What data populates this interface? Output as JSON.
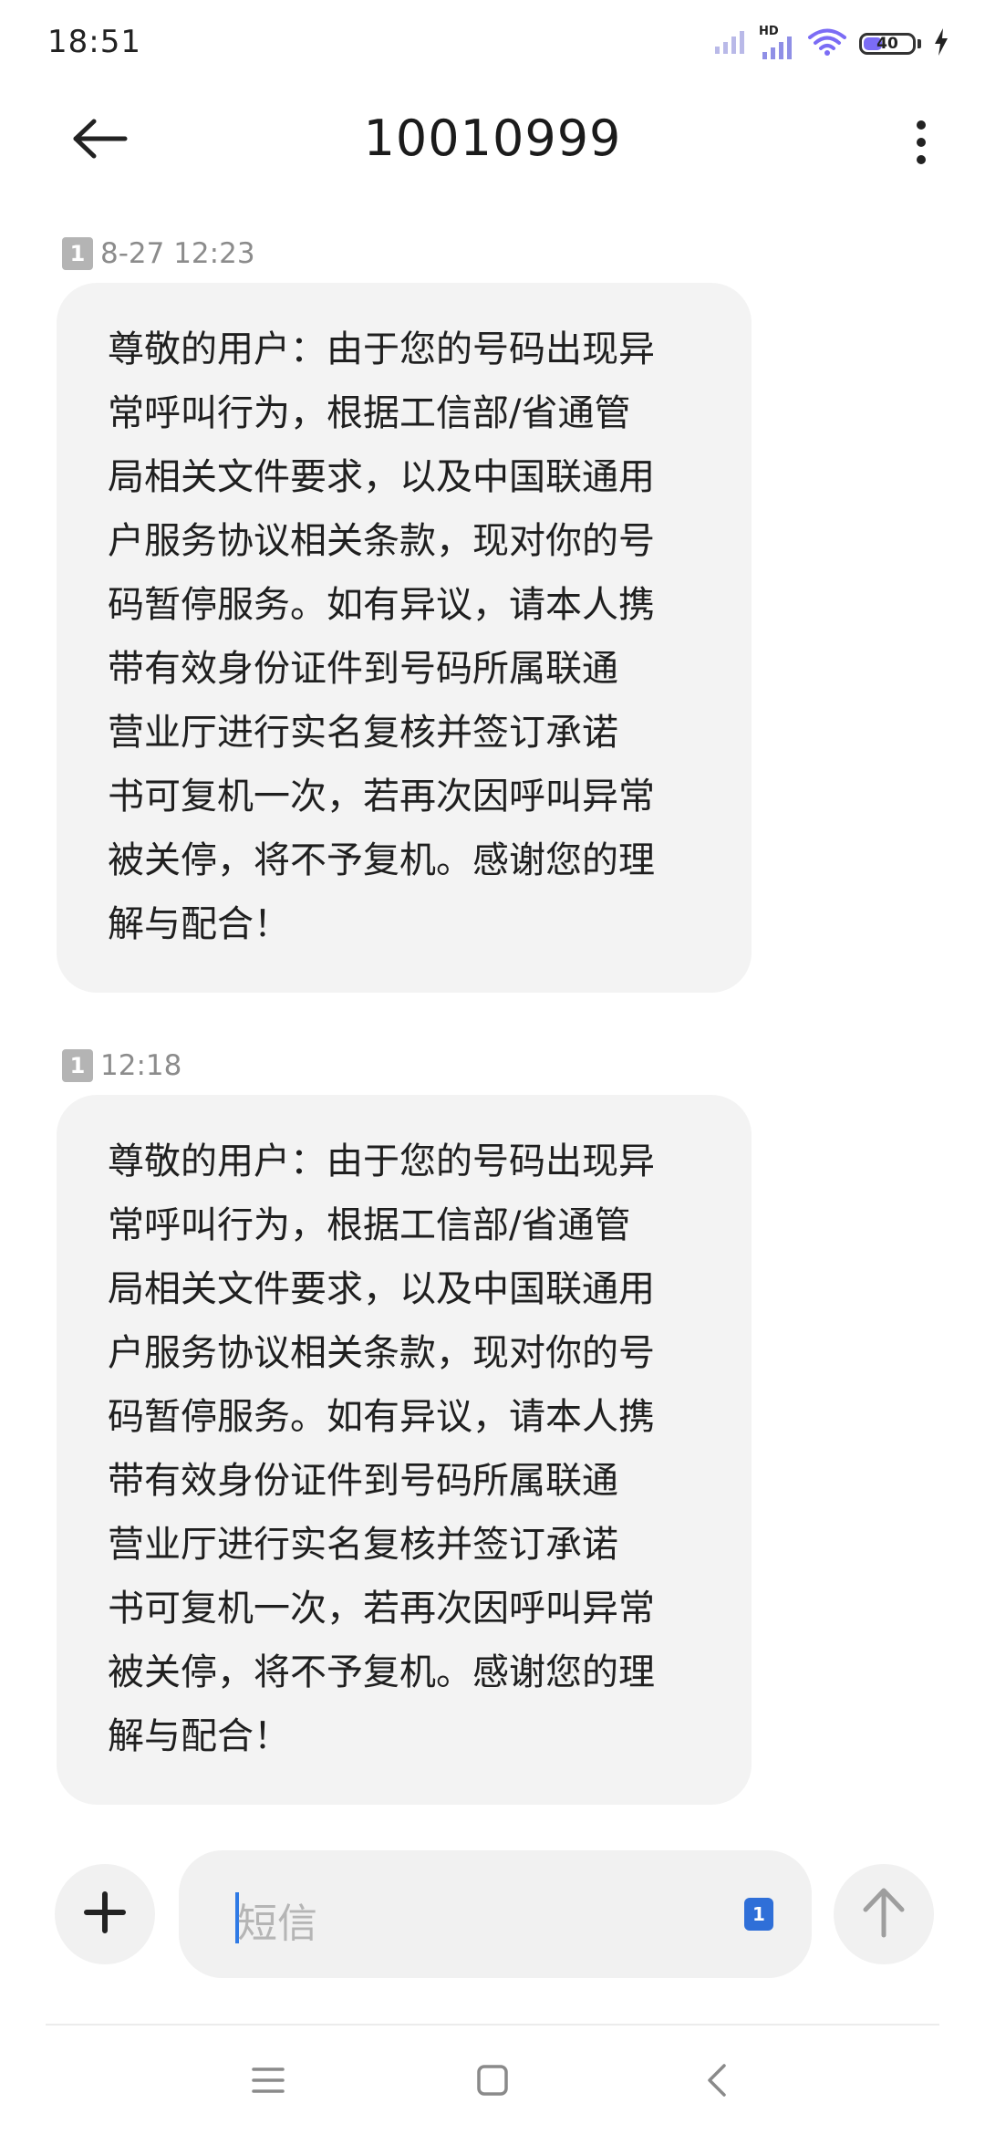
{
  "status_bar": {
    "time": "18:51",
    "hd_label": "HD",
    "battery_level": "40",
    "battery_percent": 40,
    "icons": [
      "signal-icon",
      "signal-hd-icon",
      "wifi-icon",
      "battery-icon",
      "charging-bolt-icon"
    ]
  },
  "header": {
    "title": "10010999",
    "back_icon": "arrow-left-icon",
    "more_icon": "more-vertical-icon"
  },
  "messages": [
    {
      "sim": "1",
      "time": "8-27 12:23",
      "text": "尊敬的用户：由于您的号码出现异\n常呼叫行为，根据工信部/省通管\n局相关文件要求，以及中国联通用\n户服务协议相关条款，现对你的号\n码暂停服务。如有异议，请本人携\n带有效身份证件到号码所属联通\n营业厅进行实名复核并签订承诺\n书可复机一次，若再次因呼叫异常\n被关停，将不予复机。感谢您的理\n解与配合！"
    },
    {
      "sim": "1",
      "time": "12:18",
      "text": "尊敬的用户：由于您的号码出现异\n常呼叫行为，根据工信部/省通管\n局相关文件要求，以及中国联通用\n户服务协议相关条款，现对你的号\n码暂停服务。如有异议，请本人携\n带有效身份证件到号码所属联通\n营业厅进行实名复核并签订承诺\n书可复机一次，若再次因呼叫异常\n被关停，将不予复机。感谢您的理\n解与配合！"
    }
  ],
  "composer": {
    "placeholder": "短信",
    "sim": "1",
    "add_icon": "plus-icon",
    "send_icon": "arrow-up-icon"
  },
  "nav_bar": {
    "icons": [
      "menu-icon",
      "home-icon",
      "back-chevron-icon"
    ]
  },
  "colors": {
    "bubble_bg": "#f3f3f3",
    "accent": "#2f6fd8",
    "battery_accent": "#7b6cf5",
    "meta_text": "#8c8c8c"
  }
}
